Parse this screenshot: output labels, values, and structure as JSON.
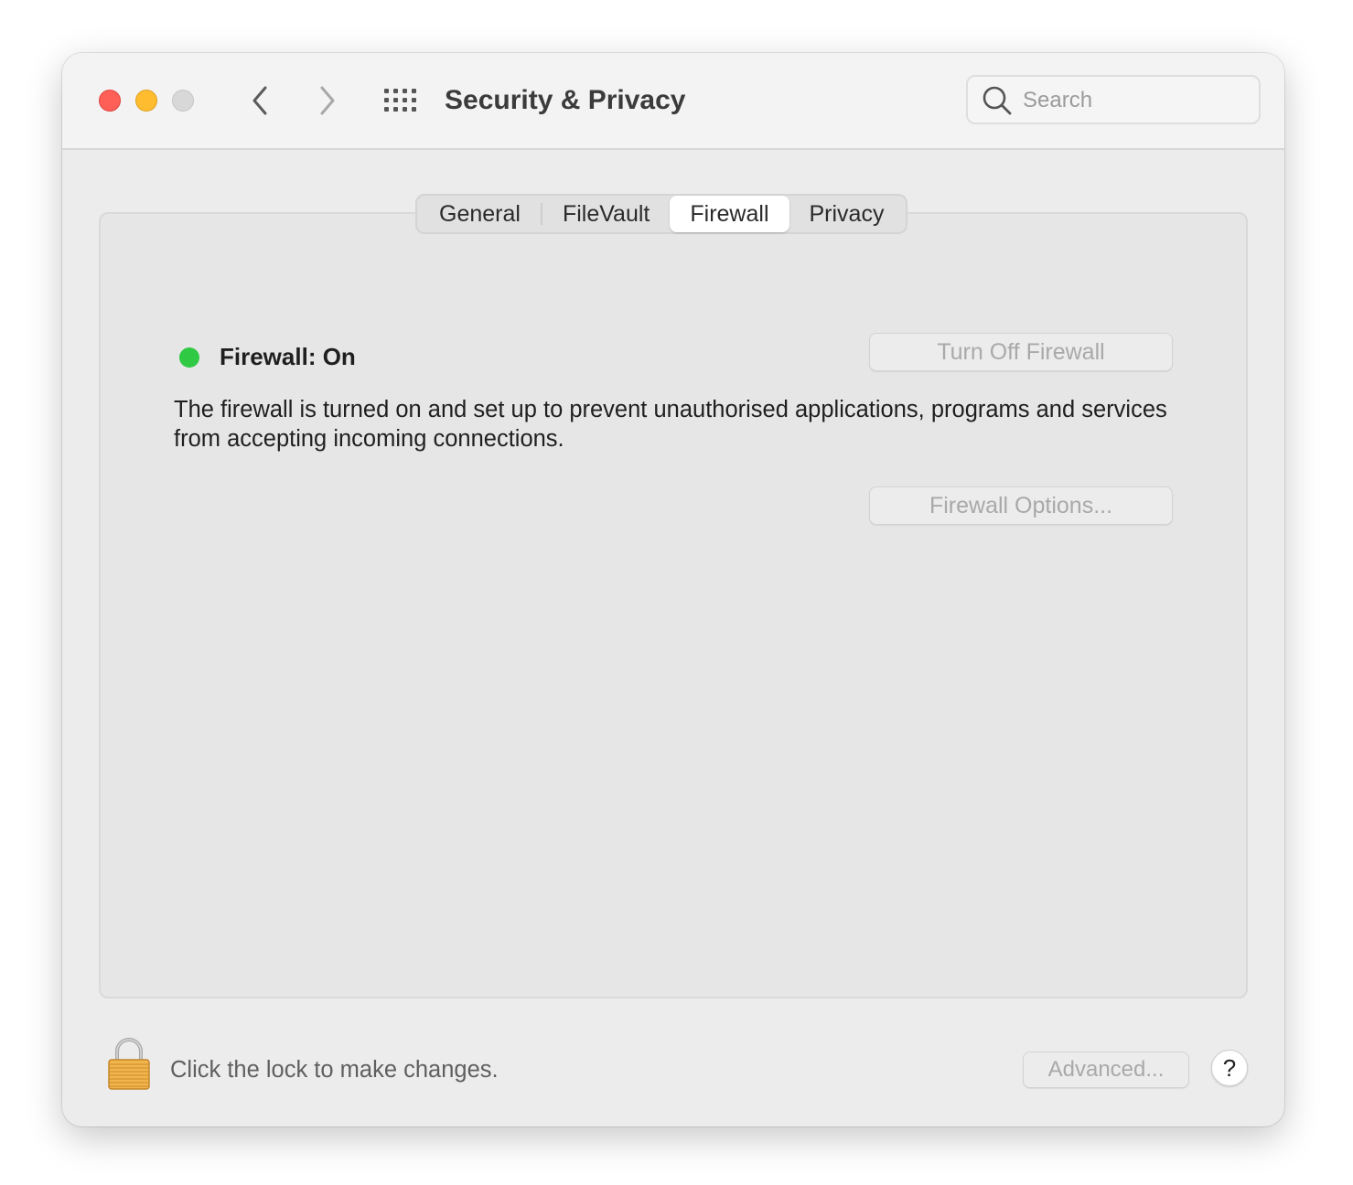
{
  "window": {
    "title": "Security & Privacy"
  },
  "search": {
    "placeholder": "Search"
  },
  "tabs": [
    {
      "label": "General",
      "active": false
    },
    {
      "label": "FileVault",
      "active": false
    },
    {
      "label": "Firewall",
      "active": true
    },
    {
      "label": "Privacy",
      "active": false
    }
  ],
  "firewall": {
    "status": "Firewall: On",
    "status_color": "#2fc944",
    "turn_off_label": "Turn Off Firewall",
    "description": "The firewall is turned on and set up to prevent unauthorised applications, programs and services from accepting incoming connections.",
    "options_label": "Firewall Options..."
  },
  "footer": {
    "lock_text": "Click the lock to make changes.",
    "advanced_label": "Advanced...",
    "help_label": "?"
  },
  "icons": {
    "close": "close-icon",
    "minimize": "minimize-icon",
    "maximize": "maximize-icon",
    "back": "chevron-left-icon",
    "forward": "chevron-right-icon",
    "grid": "grid-icon",
    "search": "search-icon",
    "lock": "lock-icon"
  },
  "colors": {
    "close": "#fe5f57",
    "minimize": "#febc2e",
    "maximize": "#d8d8d8"
  }
}
